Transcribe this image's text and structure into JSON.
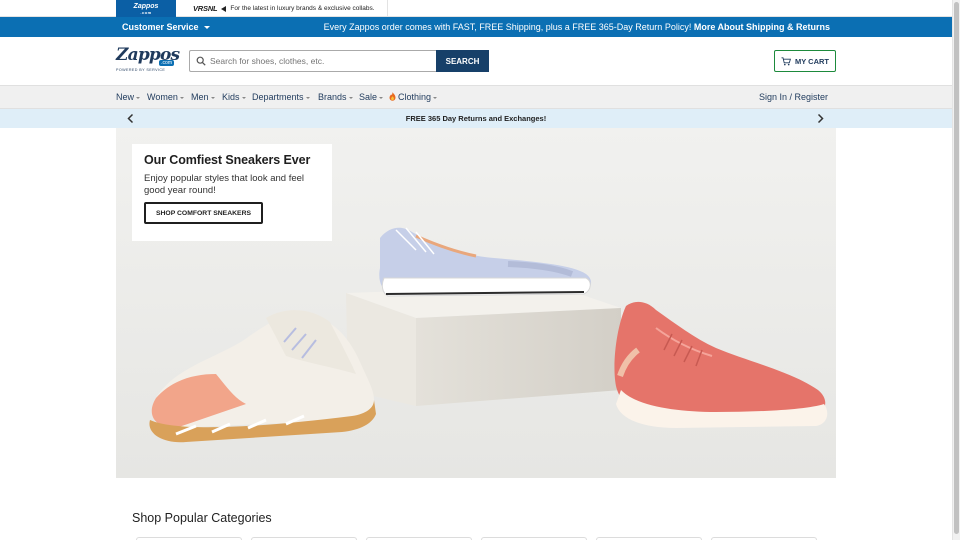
{
  "property_bar": {
    "zappos_tab": "Zappos",
    "zappos_tab_sub": ".com",
    "vrsnl_logo": "VRSNL",
    "vrsnl_text": "For the latest in luxury brands & exclusive collabs."
  },
  "promo_bar": {
    "customer_service": "Customer Service",
    "message": "Every Zappos order comes with FAST, FREE Shipping, plus a FREE 365-Day Return Policy!",
    "link": "More About Shipping & Returns"
  },
  "header": {
    "logo_word": "Zappos",
    "logo_dotcom": ".com",
    "logo_tagline": "POWERED BY SERVICE",
    "search_placeholder": "Search for shoes, clothes, etc.",
    "search_button": "SEARCH",
    "cart_label": "MY CART"
  },
  "nav": {
    "items": [
      {
        "label": "New"
      },
      {
        "label": "Women"
      },
      {
        "label": "Men"
      },
      {
        "label": "Kids"
      },
      {
        "label": "Departments"
      },
      {
        "label": "Brands"
      },
      {
        "label": "Sale"
      },
      {
        "label": "Clothing"
      }
    ],
    "sign_in": "Sign In / Register"
  },
  "returns_strip": {
    "text": "FREE 365 Day Returns and Exchanges!"
  },
  "hero": {
    "title": "Our Comfiest Sneakers Ever",
    "subtitle": "Enjoy popular styles that look and feel good year round!",
    "cta": "SHOP COMFORT SNEAKERS"
  },
  "categories": {
    "title": "Shop Popular Categories"
  },
  "colors": {
    "promo_blue": "#0b6fb3",
    "search_navy": "#174069",
    "cart_green": "#1d8a3c",
    "returns_bg": "#dfeef8"
  }
}
